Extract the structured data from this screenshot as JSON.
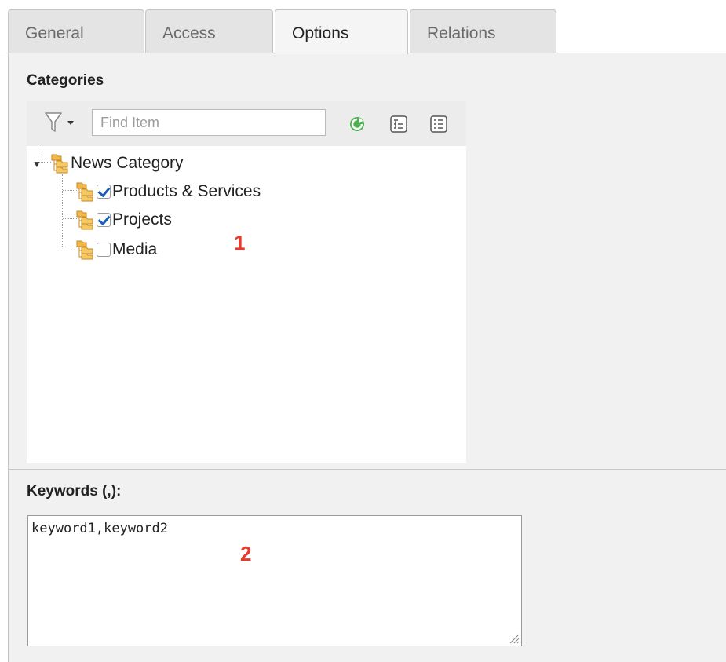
{
  "tabs": [
    {
      "label": "General",
      "active": false
    },
    {
      "label": "Access",
      "active": false
    },
    {
      "label": "Options",
      "active": true
    },
    {
      "label": "Relations",
      "active": false
    }
  ],
  "categories": {
    "label": "Categories",
    "search_placeholder": "Find Item",
    "tree": {
      "root": "News Category",
      "items": [
        {
          "label": "Products & Services",
          "checked": true
        },
        {
          "label": "Projects",
          "checked": true
        },
        {
          "label": "Media",
          "checked": false
        }
      ]
    },
    "annotation": "1"
  },
  "keywords": {
    "label": "Keywords (,):",
    "value": "keyword1,keyword2",
    "annotation": "2"
  },
  "colors": {
    "folder": "#f0b84a",
    "check": "#1a5fb4",
    "annotation": "#e8392b",
    "refresh": "#3aa43a"
  },
  "icons": [
    "filter-icon",
    "refresh-icon",
    "expand-all-icon",
    "collapse-all-icon",
    "folder-icon",
    "resize-grip-icon"
  ]
}
